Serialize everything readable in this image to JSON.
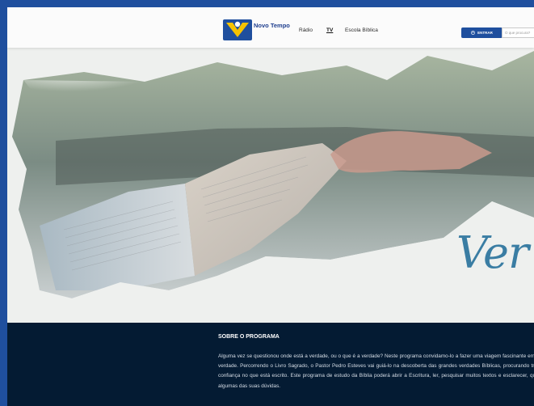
{
  "header": {
    "brand_name": "Novo Tempo",
    "brand_sub": "",
    "nav": [
      "Rádio",
      "TV",
      "Escola Bíblica"
    ],
    "active_nav": "TV",
    "login_label": "ENTRAR",
    "search_placeholder": "O que procura?"
  },
  "hero": {
    "title_script": "Ver"
  },
  "about": {
    "heading": "SOBRE O PROGRAMA",
    "text": "Alguma vez se questionou onde está a verdade, ou o que é a verdade? Neste programa convidamo-lo a fazer uma viagem fascinante em busca da verdade. Percorrendo o Livro Sagrado, o Pastor Pedro Esteves vai guiá-lo na descoberta das grandes verdades Bíblicas, procurando trazer luz e confiança no que está escrito. Este programa de estudo da Bíblia poderá abrir a Escritura, ler, pesquisar muitos textos e esclarecer, quem sabe, algumas das suas dúvidas."
  },
  "colors": {
    "accent": "#1f4f9e",
    "dark_section": "#041b33",
    "script_title": "#3a7da3",
    "logo_yellow": "#f6c300"
  }
}
